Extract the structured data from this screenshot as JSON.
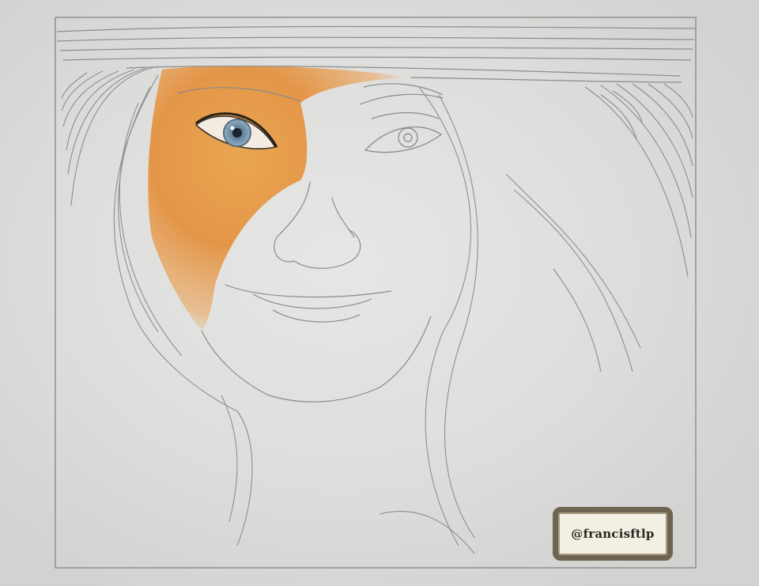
{
  "watermark": {
    "handle": "@francisftlp"
  },
  "colors": {
    "paper": "#e2e2e0",
    "pencil": "#8c8c8a",
    "skin_tone": "#e4963e",
    "iris": "#7a98ae"
  }
}
